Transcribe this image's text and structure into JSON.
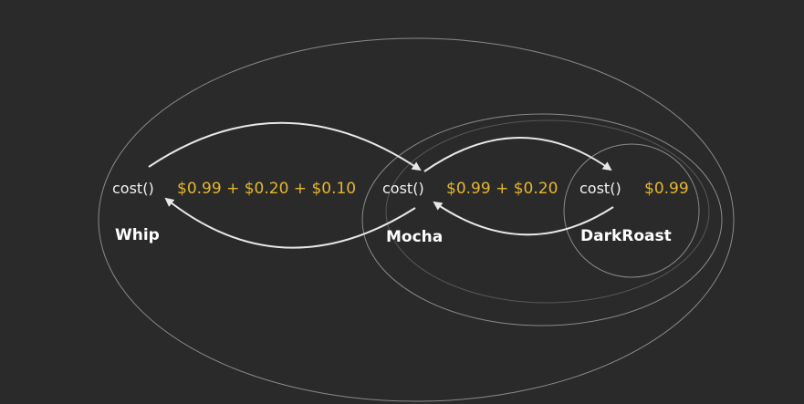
{
  "colors": {
    "background": "#2a2a2a",
    "price": "#e5b630",
    "method": "#f2f2f2",
    "ring": "#8a8a8a",
    "arrow": "#e8e8e8"
  },
  "objects": [
    {
      "name": "Whip",
      "method": "cost()",
      "price": "$0.99 + $0.20 + $0.10"
    },
    {
      "name": "Mocha",
      "method": "cost()",
      "price": "$0.99 + $0.20"
    },
    {
      "name": "DarkRoast",
      "method": "cost()",
      "price": "$0.99"
    }
  ]
}
